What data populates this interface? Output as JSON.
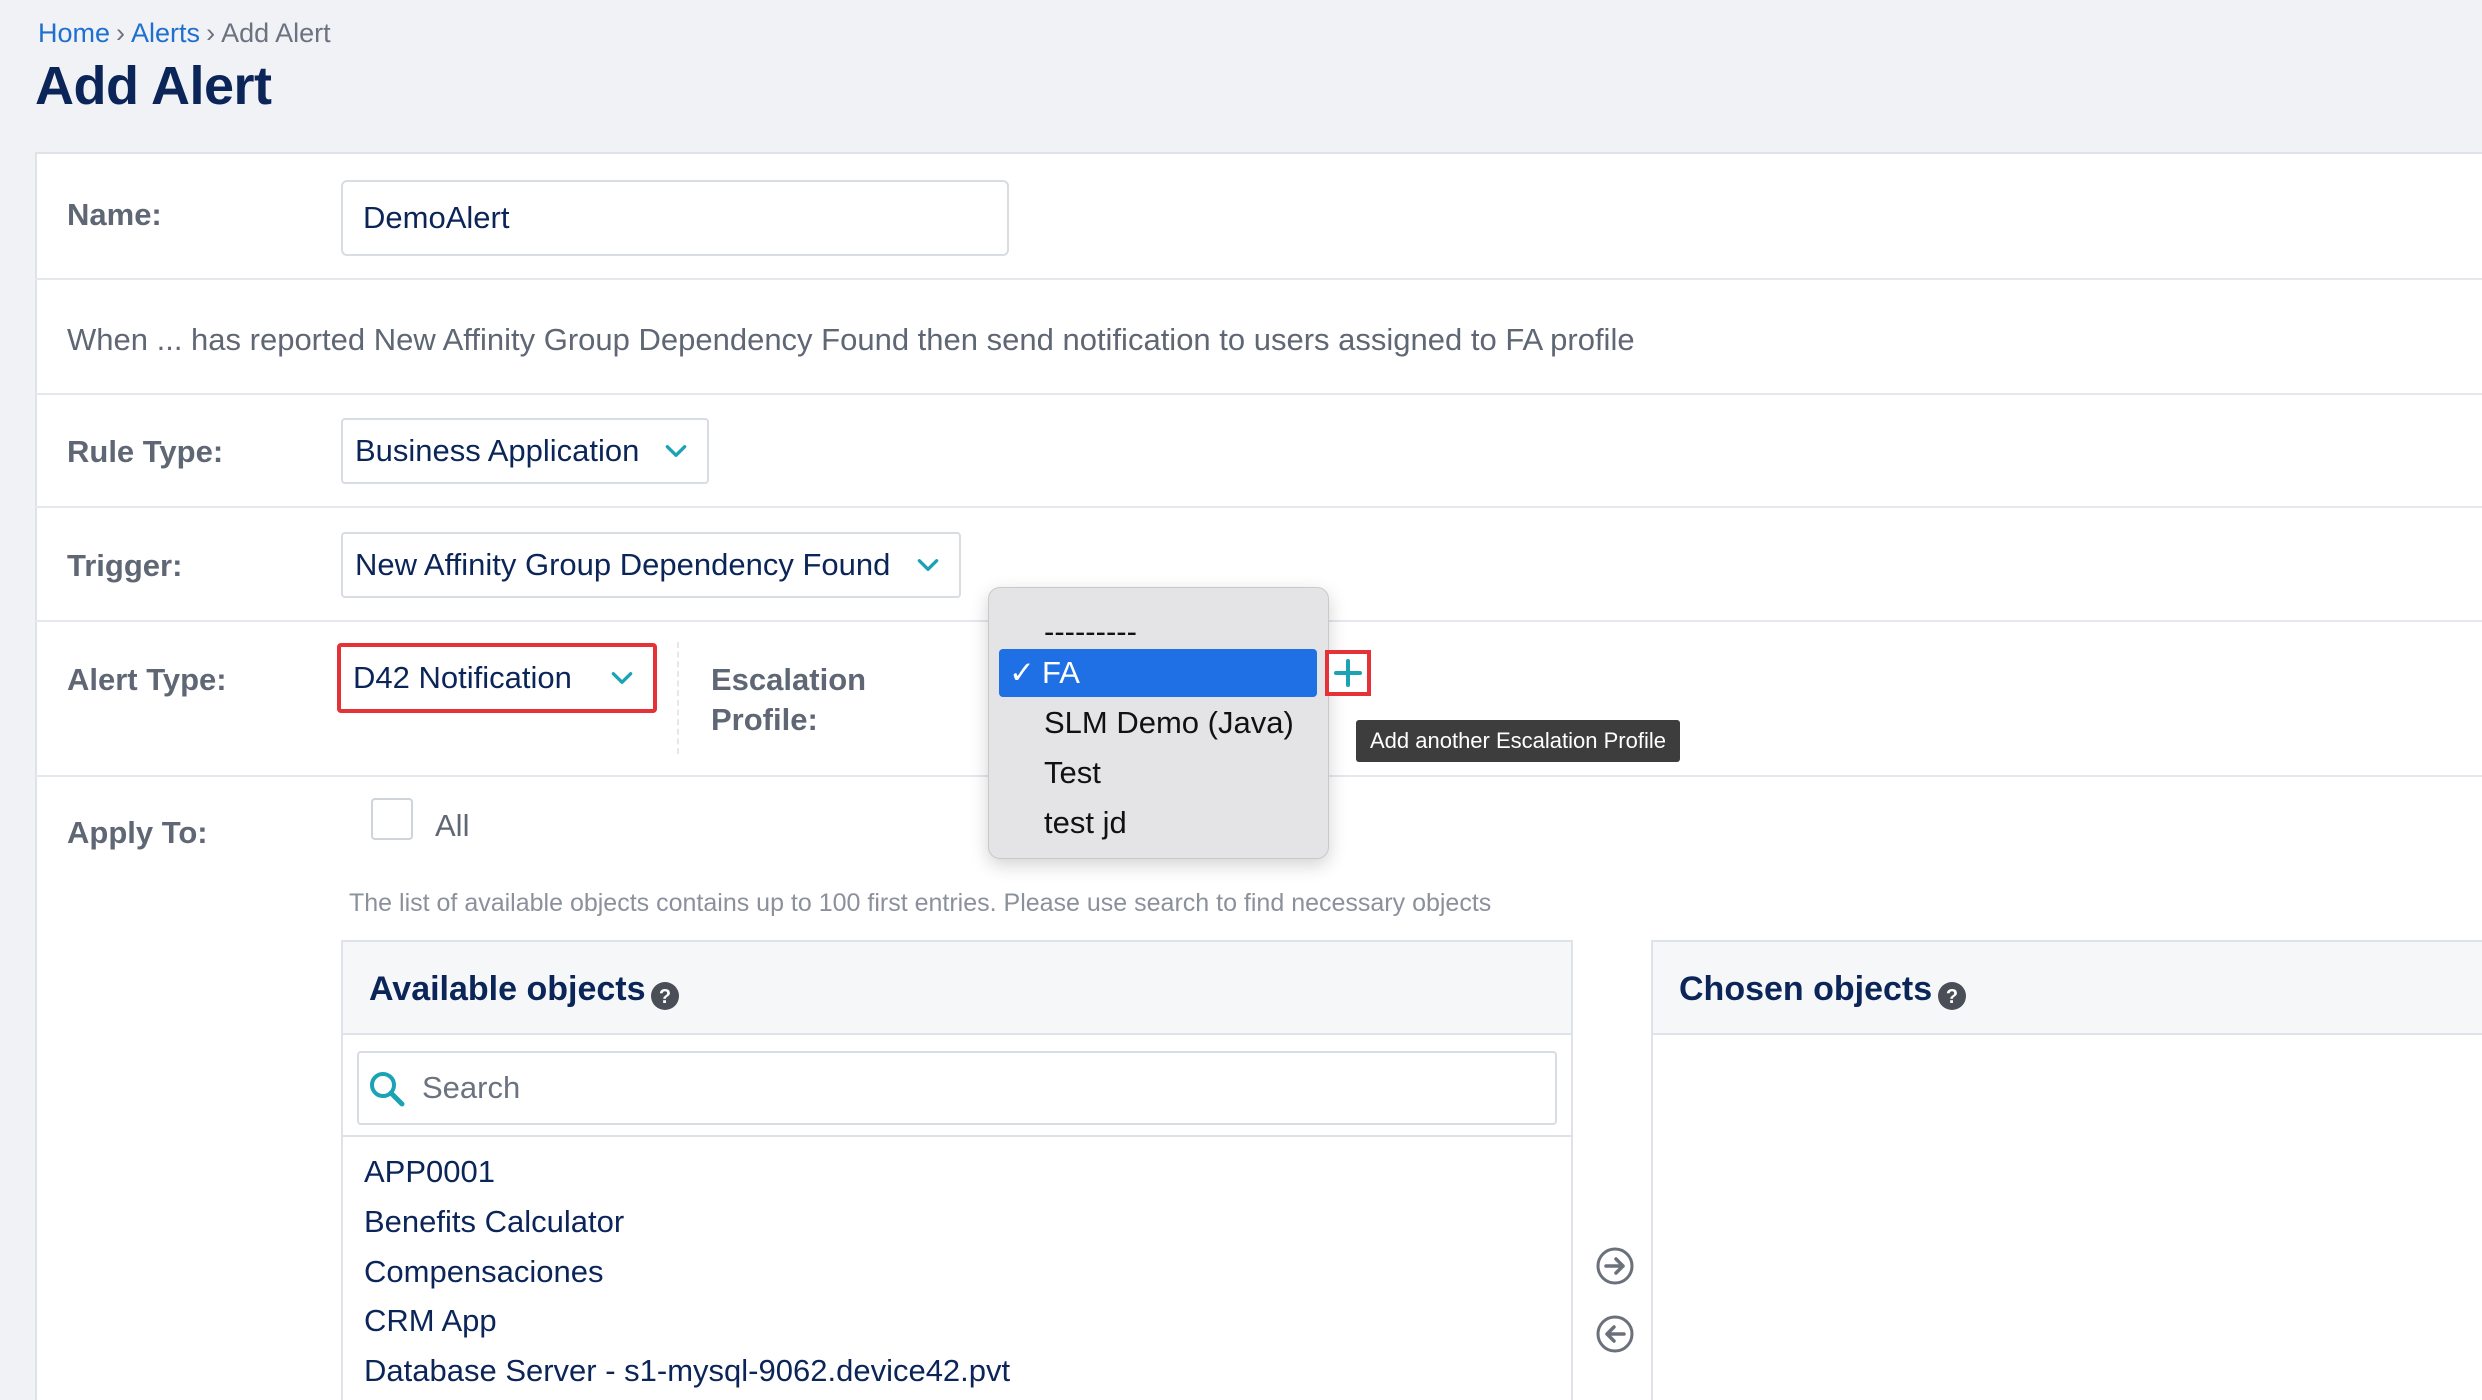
{
  "breadcrumb": {
    "home": "Home",
    "alerts": "Alerts",
    "current": "Add Alert",
    "separator": "›"
  },
  "page_title": "Add Alert",
  "form": {
    "name_label": "Name:",
    "name_value": "DemoAlert",
    "description": "When ... has reported New Affinity Group Dependency Found then send notification to users assigned to FA profile",
    "rule_type_label": "Rule Type:",
    "rule_type_value": "Business Application",
    "trigger_label": "Trigger:",
    "trigger_value": "New Affinity Group Dependency Found",
    "alert_type_label": "Alert Type:",
    "alert_type_value": "D42 Notification",
    "escalation_label_line1": "Escalation",
    "escalation_label_line2": "Profile:",
    "apply_to_label": "Apply To:",
    "all_label": "All",
    "hint": "The list of available objects contains up to 100 first entries. Please use search to find necessary objects"
  },
  "escalation_dropdown": {
    "options": [
      "---------",
      "FA",
      "SLM Demo (Java)",
      "Test",
      "test jd"
    ],
    "selected": "FA",
    "check_glyph": "✓",
    "add_tooltip": "Add another Escalation Profile"
  },
  "available_objects": {
    "title": "Available objects",
    "search_placeholder": "Search",
    "items": [
      "APP0001",
      "Benefits Calculator",
      "Compensaciones",
      "CRM App",
      "Database Server - s1-mysql-9062.device42.pvt"
    ]
  },
  "chosen_objects": {
    "title": "Chosen objects"
  },
  "colors": {
    "accent": "#1f6fd1",
    "highlight": "#e53238",
    "teal": "#1aa3b5",
    "selected": "#1f6fe5"
  }
}
